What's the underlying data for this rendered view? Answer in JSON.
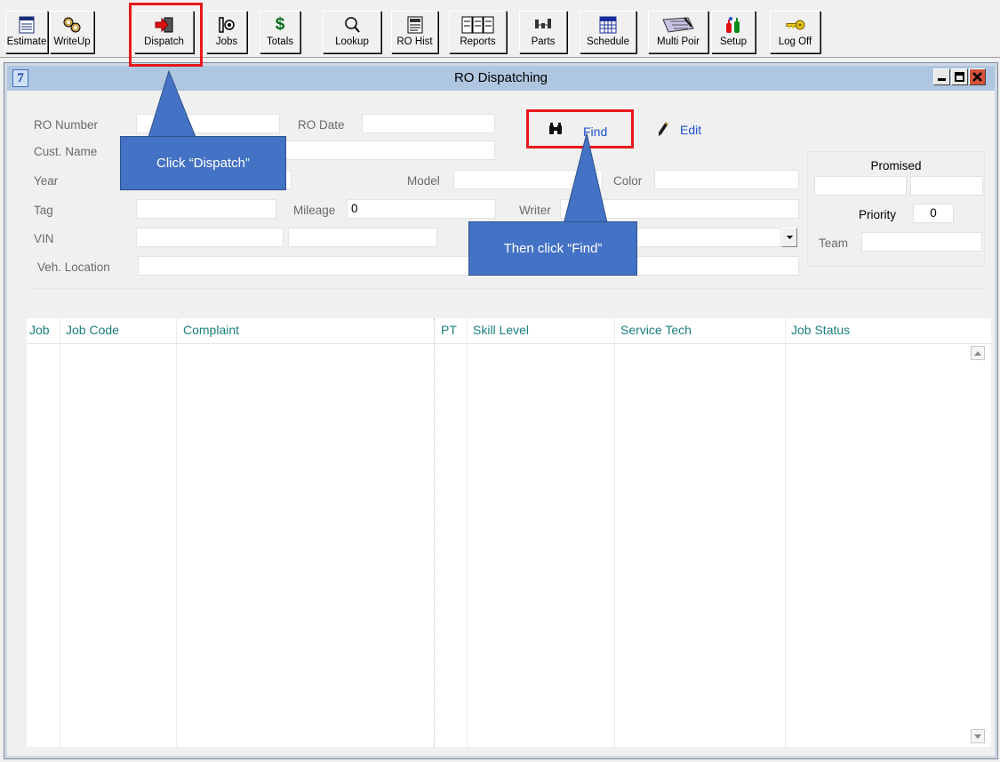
{
  "toolbar": {
    "buttons": [
      {
        "label": "Estimate",
        "icon": "estimate-icon"
      },
      {
        "label": "WriteUp",
        "icon": "writeup-icon"
      },
      {
        "label": "Dispatch",
        "icon": "dispatch-icon"
      },
      {
        "label": "Jobs",
        "icon": "jobs-icon"
      },
      {
        "label": "Totals",
        "icon": "dollar-icon"
      },
      {
        "label": "Lookup",
        "icon": "magnifier-icon"
      },
      {
        "label": "RO Hist",
        "icon": "ro-hist-icon"
      },
      {
        "label": "Reports",
        "icon": "reports-icon"
      },
      {
        "label": "Parts",
        "icon": "parts-icon"
      },
      {
        "label": "Schedule",
        "icon": "calendar-icon"
      },
      {
        "label": "Multi Poir",
        "icon": "multi-point-icon"
      },
      {
        "label": "Setup",
        "icon": "setup-icon"
      },
      {
        "label": "Log Off",
        "icon": "key-icon"
      }
    ]
  },
  "window": {
    "system_icon_text": "7",
    "title": "RO Dispatching"
  },
  "form": {
    "ro_number_label": "RO Number",
    "ro_date_label": "RO Date",
    "cust_name_label": "Cust. Name",
    "year_label": "Year",
    "model_label": "Model",
    "color_label": "Color",
    "tag_label": "Tag",
    "mileage_label": "Mileage",
    "mileage_value": "0",
    "writer_label": "Writer",
    "vin_label": "VIN",
    "veh_location_label": "Veh. Location",
    "find_label": "Find",
    "edit_label": "Edit",
    "promised_label": "Promised",
    "priority_label": "Priority",
    "priority_value": "0",
    "team_label": "Team"
  },
  "grid": {
    "columns": [
      "Job",
      "Job Code",
      "Complaint",
      "PT",
      "Skill Level",
      "Service Tech",
      "Job Status"
    ]
  },
  "annotations": {
    "dispatch_callout": "Click “Dispatch”",
    "find_callout": "Then click “Find”"
  },
  "colors": {
    "title_bar": "#aec6e0",
    "link": "#1f4fcf",
    "column_header": "#1b7e7e",
    "highlight": "#e8191c",
    "callout": "#4472c4"
  }
}
